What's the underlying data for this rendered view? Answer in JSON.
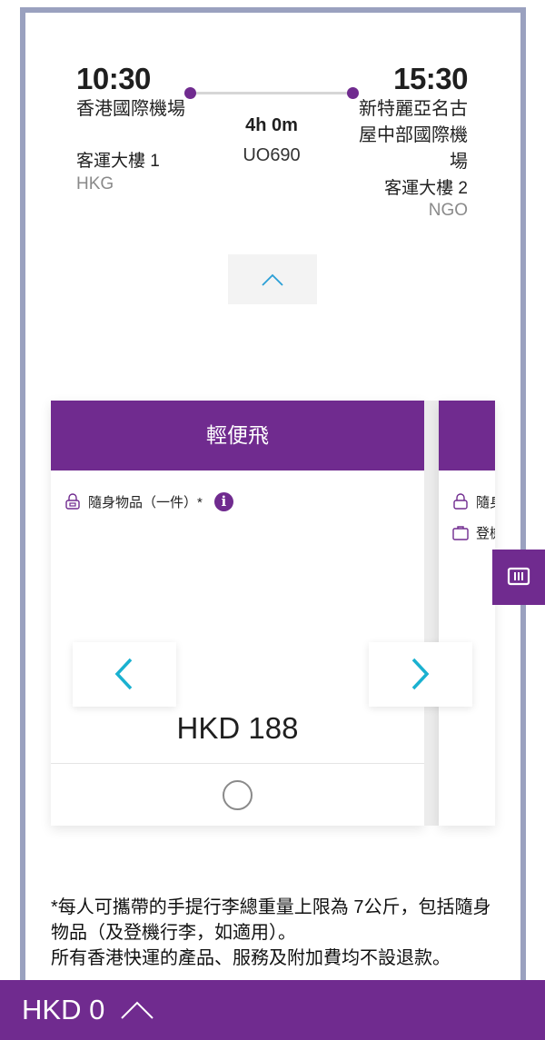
{
  "flight": {
    "departure": {
      "time": "10:30",
      "airport": "香港國際機場",
      "terminal": "客運大樓 1",
      "code": "HKG"
    },
    "arrival": {
      "time": "15:30",
      "airport": "新特麗亞名古屋中部國際機場",
      "terminal": "客運大樓 2",
      "code": "NGO"
    },
    "duration": "4h 0m",
    "flight_number": "UO690"
  },
  "fare_card": {
    "title": "輕便飛",
    "feature": "隨身物品（一件）*",
    "info_glyph": "i",
    "price": "HKD 188"
  },
  "next_card": {
    "feature_1": "隨身",
    "feature_2": "登機"
  },
  "note": {
    "line1": "*每人可攜帶的手提行李總重量上限為 7公斤，包括隨身物品（及登機行李，如適用）。",
    "line2": "所有香港快運的產品、服務及附加費均不設退款。"
  },
  "bottom_bar": {
    "total": "HKD 0"
  },
  "colors": {
    "brand": "#702b8f",
    "accent": "#1ab1d0",
    "frame": "#9aa1bf"
  },
  "icons": {
    "bag": "personal-item-icon",
    "suitcase": "cabin-bag-icon",
    "info": "info-icon",
    "prev": "chevron-left-icon",
    "next": "chevron-right-icon",
    "collapse": "chevron-up-icon",
    "side": "columns-icon"
  }
}
